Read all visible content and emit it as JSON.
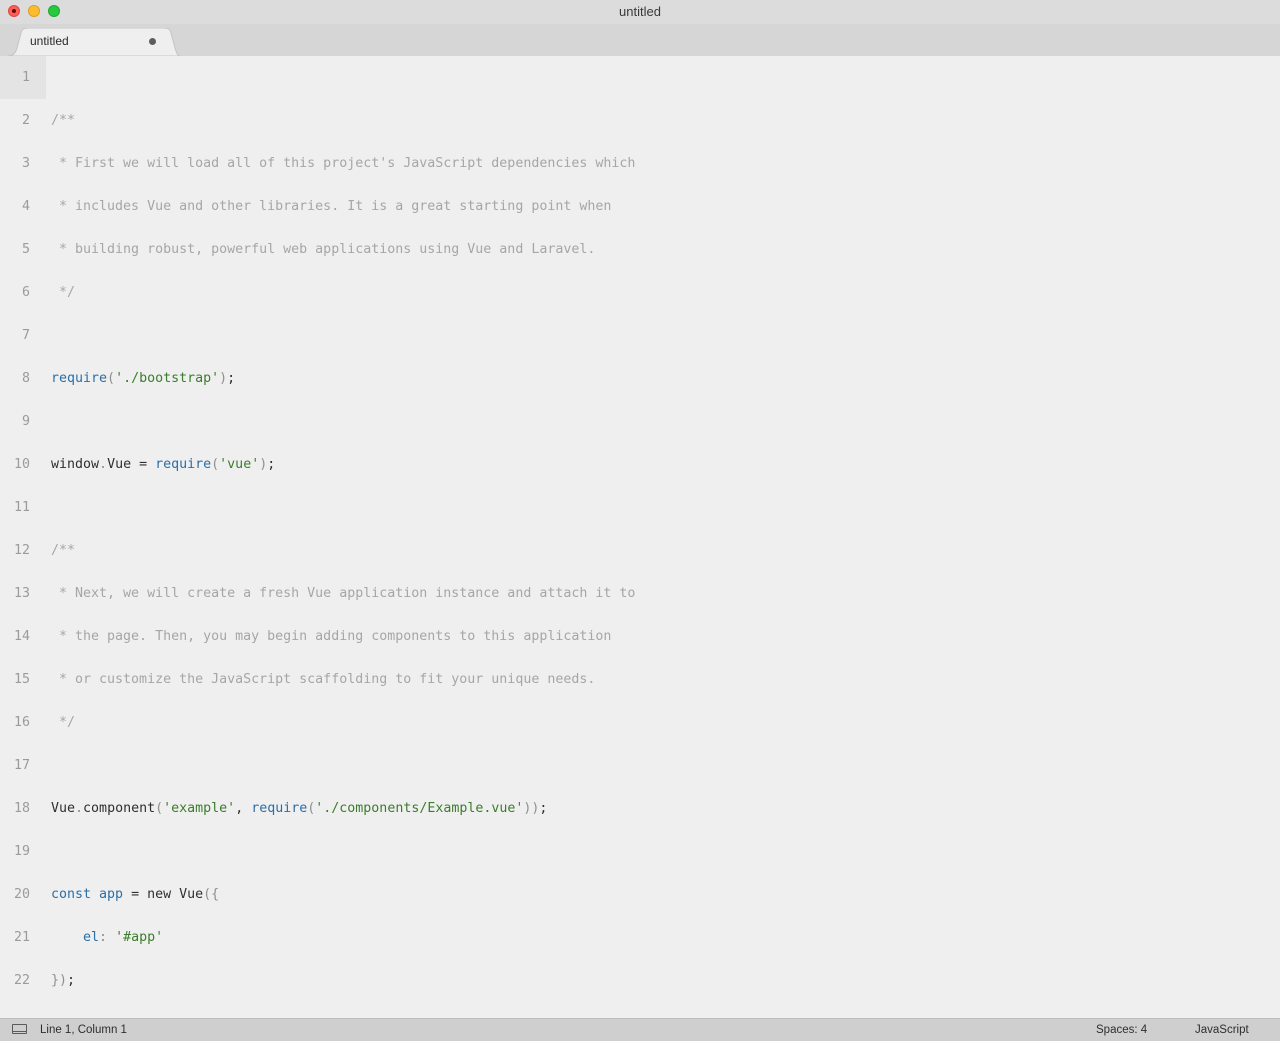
{
  "window": {
    "title": "untitled"
  },
  "tab": {
    "label": "untitled",
    "modified_indicator": "dirty-dot-icon"
  },
  "editor": {
    "lines": [
      {
        "number": "1",
        "tokens": []
      },
      {
        "number": "2",
        "tokens": [
          {
            "t": "/**",
            "c": "comment"
          }
        ]
      },
      {
        "number": "3",
        "tokens": [
          {
            "t": " * First we will load all of this project's JavaScript dependencies which",
            "c": "comment"
          }
        ]
      },
      {
        "number": "4",
        "tokens": [
          {
            "t": " * includes Vue and other libraries. It is a great starting point when",
            "c": "comment"
          }
        ]
      },
      {
        "number": "5",
        "tokens": [
          {
            "t": " * building robust, powerful web applications using Vue and Laravel.",
            "c": "comment"
          }
        ]
      },
      {
        "number": "6",
        "tokens": [
          {
            "t": " */",
            "c": "comment"
          }
        ]
      },
      {
        "number": "7",
        "tokens": []
      },
      {
        "number": "8",
        "tokens": [
          {
            "t": "require",
            "c": "func"
          },
          {
            "t": "(",
            "c": "punc"
          },
          {
            "t": "'./bootstrap'",
            "c": "str"
          },
          {
            "t": ")",
            "c": "punc"
          },
          {
            "t": ";",
            "c": "plain"
          }
        ]
      },
      {
        "number": "9",
        "tokens": []
      },
      {
        "number": "10",
        "tokens": [
          {
            "t": "window",
            "c": "plain"
          },
          {
            "t": ".",
            "c": "punc"
          },
          {
            "t": "Vue = ",
            "c": "plain"
          },
          {
            "t": "require",
            "c": "func"
          },
          {
            "t": "(",
            "c": "punc"
          },
          {
            "t": "'vue'",
            "c": "str"
          },
          {
            "t": ")",
            "c": "punc"
          },
          {
            "t": ";",
            "c": "plain"
          }
        ]
      },
      {
        "number": "11",
        "tokens": []
      },
      {
        "number": "12",
        "tokens": [
          {
            "t": "/**",
            "c": "comment"
          }
        ]
      },
      {
        "number": "13",
        "tokens": [
          {
            "t": " * Next, we will create a fresh Vue application instance and attach it to",
            "c": "comment"
          }
        ]
      },
      {
        "number": "14",
        "tokens": [
          {
            "t": " * the page. Then, you may begin adding components to this application",
            "c": "comment"
          }
        ]
      },
      {
        "number": "15",
        "tokens": [
          {
            "t": " * or customize the JavaScript scaffolding to fit your unique needs.",
            "c": "comment"
          }
        ]
      },
      {
        "number": "16",
        "tokens": [
          {
            "t": " */",
            "c": "comment"
          }
        ]
      },
      {
        "number": "17",
        "tokens": []
      },
      {
        "number": "18",
        "tokens": [
          {
            "t": "Vue",
            "c": "plain"
          },
          {
            "t": ".",
            "c": "punc"
          },
          {
            "t": "component",
            "c": "plain"
          },
          {
            "t": "(",
            "c": "punc"
          },
          {
            "t": "'example'",
            "c": "str"
          },
          {
            "t": ", ",
            "c": "plain"
          },
          {
            "t": "require",
            "c": "func"
          },
          {
            "t": "(",
            "c": "punc"
          },
          {
            "t": "'./components/Example.vue'",
            "c": "str"
          },
          {
            "t": "))",
            "c": "punc"
          },
          {
            "t": ";",
            "c": "plain"
          }
        ]
      },
      {
        "number": "19",
        "tokens": []
      },
      {
        "number": "20",
        "tokens": [
          {
            "t": "const ",
            "c": "key"
          },
          {
            "t": "app",
            "c": "var"
          },
          {
            "t": " = new Vue",
            "c": "plain"
          },
          {
            "t": "({",
            "c": "punc"
          }
        ]
      },
      {
        "number": "21",
        "tokens": [
          {
            "t": "    ",
            "c": "plain"
          },
          {
            "t": "el",
            "c": "var"
          },
          {
            "t": ": ",
            "c": "punc"
          },
          {
            "t": "'#app'",
            "c": "str"
          }
        ]
      },
      {
        "number": "22",
        "tokens": [
          {
            "t": "})",
            "c": "punc"
          },
          {
            "t": ";",
            "c": "plain"
          }
        ]
      }
    ]
  },
  "status": {
    "panel_icon": "panel-toggle-icon",
    "position": "Line 1, Column 1",
    "indentation": "Spaces: 4",
    "syntax": "JavaScript"
  },
  "colors": {
    "comment": "#a6a6a6",
    "function": "#2a6fa8",
    "string": "#3c7d2c",
    "background": "#efefef"
  }
}
